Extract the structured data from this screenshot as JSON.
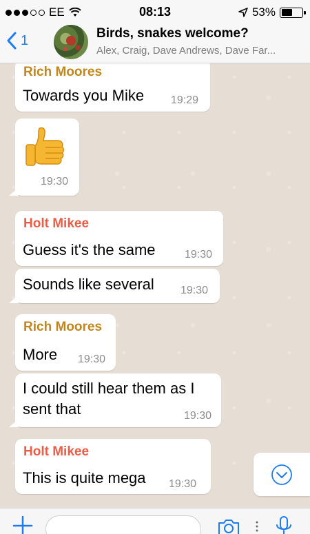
{
  "status_bar": {
    "carrier": "EE",
    "time": "08:13",
    "battery": "53%",
    "battery_level": 0.53
  },
  "header": {
    "back_count": "1",
    "title": "Birds, snakes welcome?",
    "members": "Alex, Craig, Dave Andrews, Dave Far..."
  },
  "messages": [
    {
      "sender": "Rich Moores",
      "text": "Towards you Mike",
      "time": "19:29"
    },
    {
      "sender": "",
      "text": "",
      "emoji": "thumbs-up",
      "time": "19:30"
    },
    {
      "sender": "Holt Mikee",
      "text": "Guess it's the same",
      "time": "19:30"
    },
    {
      "sender": "",
      "text": "Sounds like several",
      "time": "19:30"
    },
    {
      "sender": "Rich Moores",
      "text": "More",
      "time": "19:30"
    },
    {
      "sender": "",
      "text": "I could still hear them as I sent that",
      "time": "19:30"
    },
    {
      "sender": "Holt Mikee",
      "text": "This is quite mega",
      "time": "19:30"
    }
  ],
  "input": {
    "value": ""
  },
  "colors": {
    "accent": "#1c7cf2",
    "sender_gold": "#c3861a",
    "sender_red": "#ef5c45",
    "chat_bg": "#e6ddd4"
  },
  "icons": [
    "back-chevron-icon",
    "wifi-icon",
    "location-arrow-icon",
    "battery-icon",
    "thumbs-up-emoji",
    "scroll-down-icon",
    "plus-icon",
    "camera-icon",
    "microphone-icon"
  ]
}
